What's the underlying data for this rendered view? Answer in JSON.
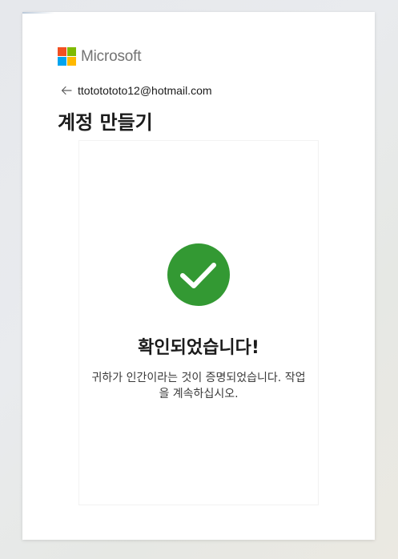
{
  "brand": {
    "name": "Microsoft",
    "colors": [
      "#f25022",
      "#7fba00",
      "#00a4ef",
      "#ffb900"
    ],
    "text_color": "#737373"
  },
  "header": {
    "back_icon": "arrow-left-icon",
    "email": "ttototototo12@hotmail.com",
    "title": "계정 만들기"
  },
  "verification": {
    "icon": "checkmark-circle-icon",
    "icon_color": "#339933",
    "heading": "확인되었습니다!",
    "message": "귀하가 인간이라는 것이 증명되었습니다. 작업을 계속하십시오."
  }
}
